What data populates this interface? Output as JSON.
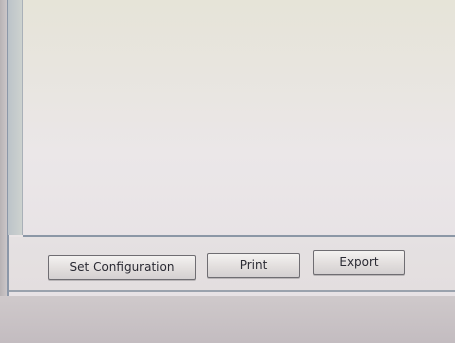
{
  "buttons": {
    "set_configuration": "Set Configuration",
    "print": "Print",
    "export": "Export"
  },
  "colors": {
    "content_background": "#e8e5e0",
    "window_border": "#8b97a6",
    "button_face": "#e2dedd",
    "button_text": "#2a2a33"
  }
}
